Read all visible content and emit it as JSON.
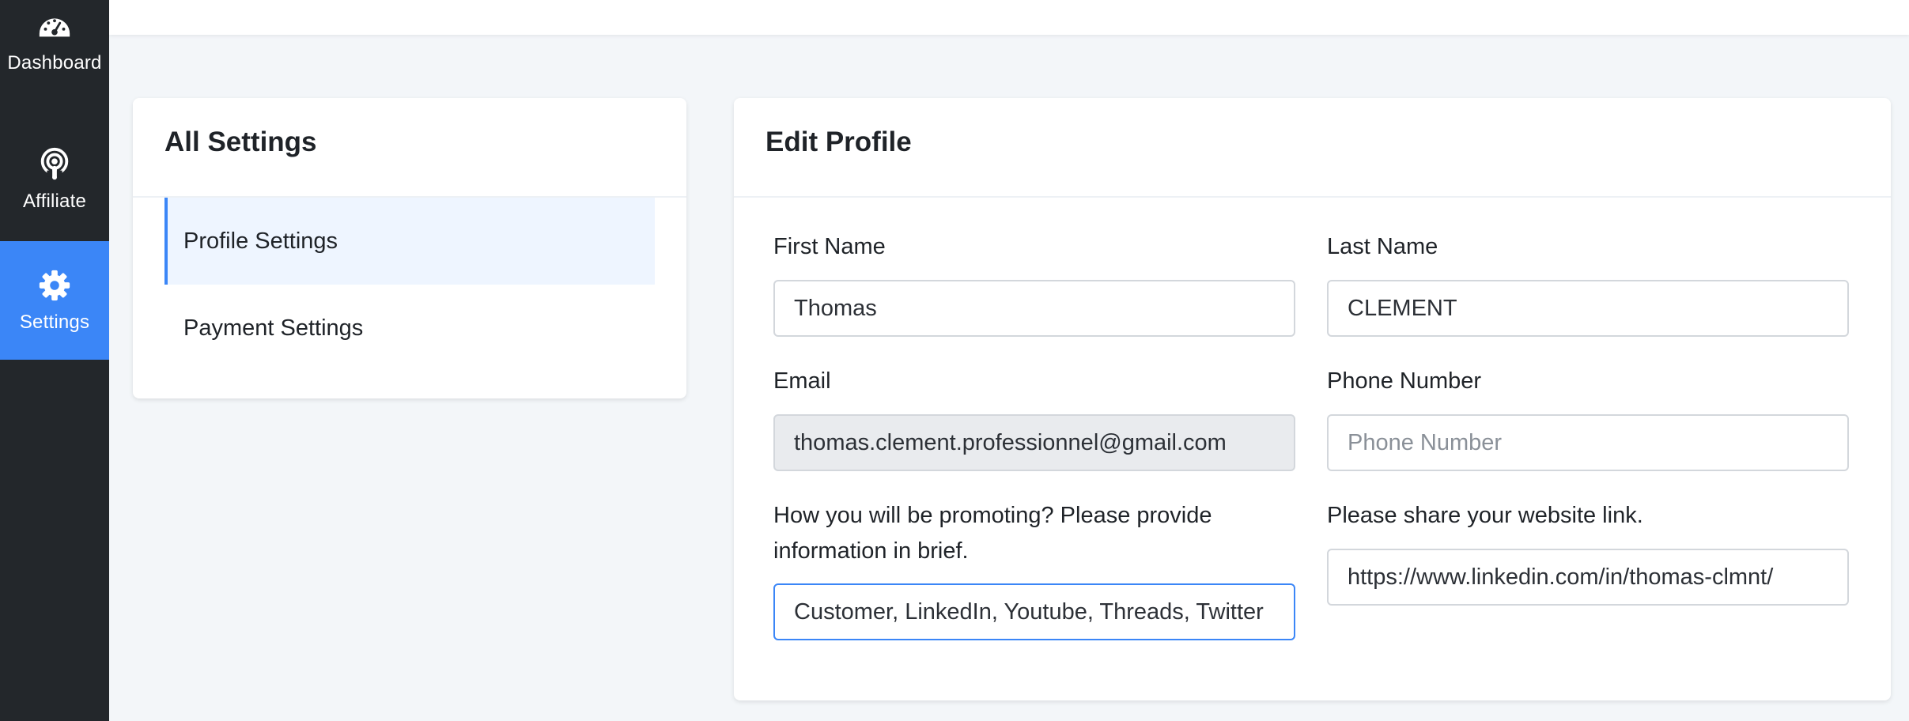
{
  "sidebar": {
    "items": [
      {
        "label": "Dashboard",
        "icon": "gauge-icon",
        "active": false
      },
      {
        "label": "Affiliate",
        "icon": "podcast-icon",
        "active": false
      },
      {
        "label": "Settings",
        "icon": "gear-icon",
        "active": true
      }
    ]
  },
  "colors": {
    "sidebar_bg": "#23272b",
    "accent": "#3b86f7",
    "page_bg": "#f3f6f9"
  },
  "settings_card": {
    "title": "All Settings",
    "menu": [
      {
        "label": "Profile Settings",
        "active": true
      },
      {
        "label": "Payment Settings",
        "active": false
      }
    ]
  },
  "profile_card": {
    "title": "Edit Profile",
    "fields": {
      "first_name": {
        "label": "First Name",
        "value": "Thomas",
        "placeholder": ""
      },
      "last_name": {
        "label": "Last Name",
        "value": "CLEMENT",
        "placeholder": ""
      },
      "email": {
        "label": "Email",
        "value": "thomas.clement.professionnel@gmail.com",
        "placeholder": ""
      },
      "phone": {
        "label": "Phone Number",
        "value": "",
        "placeholder": "Phone Number"
      },
      "promotion": {
        "label": "How you will be promoting? Please provide information in brief.",
        "value": "Customer, LinkedIn, Youtube, Threads, Twitter",
        "placeholder": ""
      },
      "website": {
        "label": "Please share your website link.",
        "value": "https://www.linkedin.com/in/thomas-clmnt/",
        "placeholder": ""
      }
    }
  }
}
